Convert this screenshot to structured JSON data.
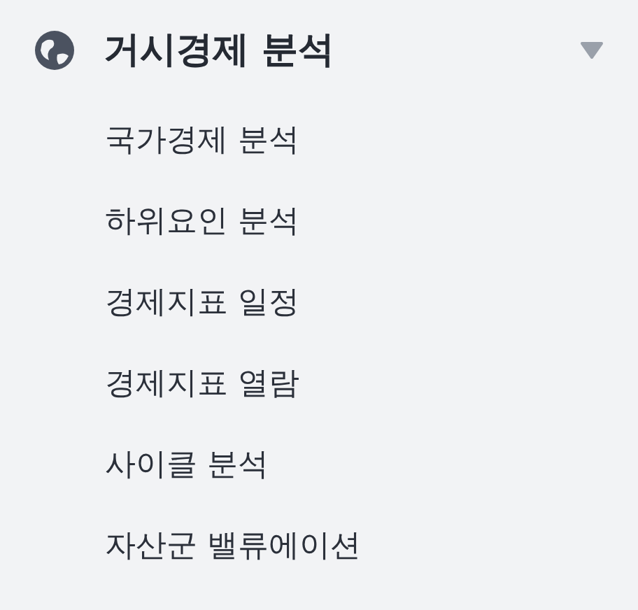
{
  "menu": {
    "title": "거시경제 분석",
    "expanded": true,
    "items": [
      {
        "label": "국가경제 분석"
      },
      {
        "label": "하위요인 분석"
      },
      {
        "label": "경제지표 일정"
      },
      {
        "label": "경제지표 열람"
      },
      {
        "label": "사이클 분석"
      },
      {
        "label": "자산군 밸류에이션"
      }
    ]
  }
}
